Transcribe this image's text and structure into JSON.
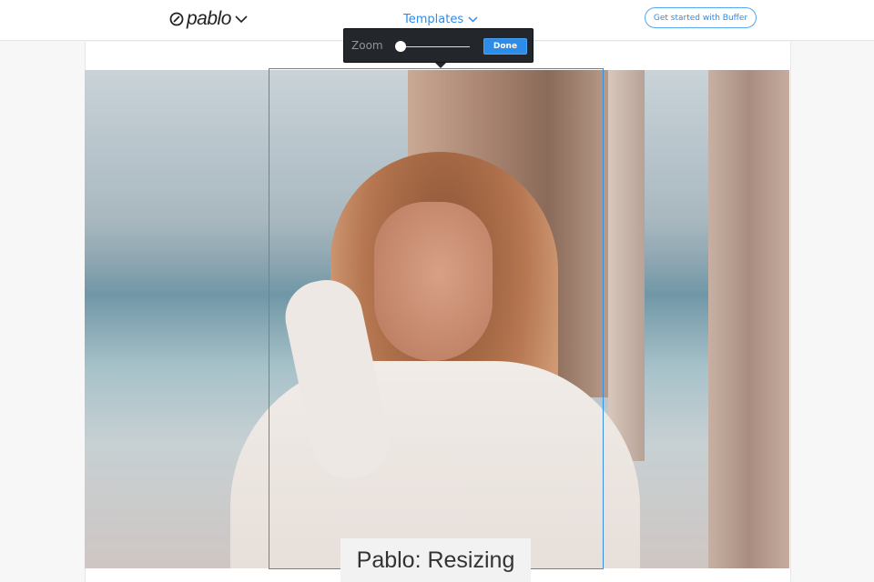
{
  "header": {
    "logo": "pablo",
    "templates_label": "Templates",
    "cta_label": "Get started with Buffer"
  },
  "zoom_popover": {
    "label": "Zoom",
    "level": 0,
    "done_label": "Done"
  },
  "caption": "Pablo: Resizing",
  "colors": {
    "accent": "#2d8ce8",
    "popover_bg": "#23262b"
  }
}
